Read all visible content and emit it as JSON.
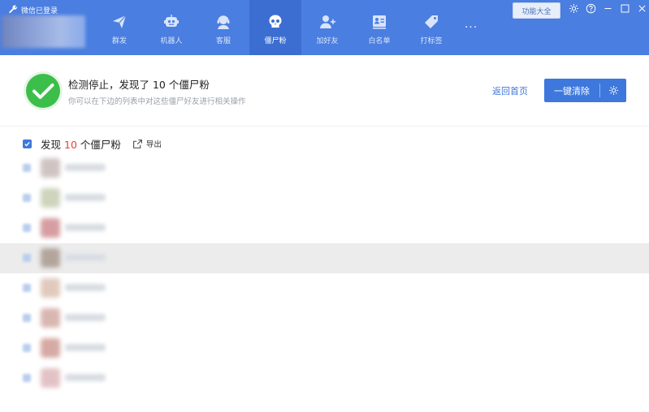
{
  "status": {
    "text": "微信已登录"
  },
  "nav": {
    "tabs": [
      {
        "label": "群发",
        "icon": "send-icon",
        "active": false
      },
      {
        "label": "机器人",
        "icon": "robot-icon",
        "active": false
      },
      {
        "label": "客服",
        "icon": "headset-icon",
        "active": false
      },
      {
        "label": "僵尸粉",
        "icon": "skull-icon",
        "active": true
      },
      {
        "label": "加好友",
        "icon": "add-friend-icon",
        "active": false
      },
      {
        "label": "白名单",
        "icon": "whitelist-icon",
        "active": false
      },
      {
        "label": "打标签",
        "icon": "tag-icon",
        "active": false
      }
    ],
    "more": "···"
  },
  "toolbar": {
    "features_label": "功能大全"
  },
  "result": {
    "title": "检测停止，发现了 10 个僵尸粉",
    "subtitle": "你可以在下边的列表中对这些僵尸好友进行相关操作",
    "back_home": "返回首页",
    "clear_all": "一键清除"
  },
  "list": {
    "found_prefix": "发现",
    "count": "10",
    "found_suffix": "个僵尸粉",
    "export_label": "导出"
  },
  "colors": {
    "accent": "#4a7ee0",
    "active_tab": "#3c6ed2",
    "success": "#3cbf4a",
    "count_red": "#e8403a"
  }
}
